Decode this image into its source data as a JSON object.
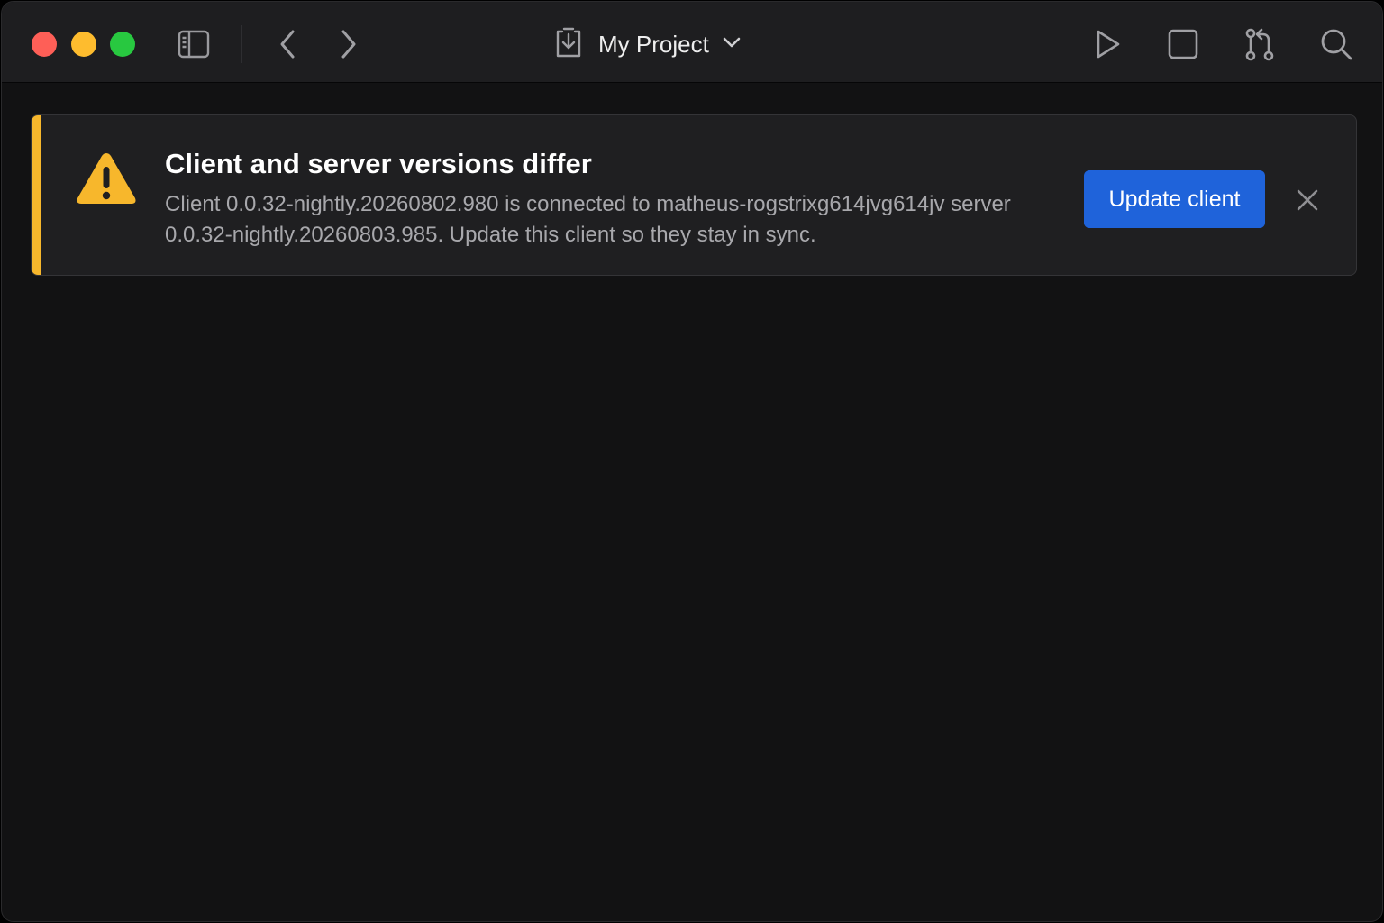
{
  "window": {
    "traffic_lights": {
      "close_color": "#fe5f57",
      "minimize_color": "#febc2e",
      "maximize_color": "#28c840"
    }
  },
  "toolbar": {
    "left_icons": [
      "sidebar-toggle-icon",
      "chevron-left-icon",
      "chevron-right-icon"
    ],
    "project": {
      "icon": "project-download-icon",
      "name": "My Project",
      "dropdown_icon": "chevron-down-icon"
    },
    "right_icons": [
      "play-icon",
      "stop-icon",
      "git-pull-request-icon",
      "search-icon"
    ]
  },
  "banner": {
    "severity": "warning",
    "accent_color": "#f7b72c",
    "icon": "warning-triangle-icon",
    "title": "Client and server versions differ",
    "message": "Client 0.0.32-nightly.20260802.980 is connected to matheus-rogstrixg614jvg614jv server 0.0.32-nightly.20260803.985. Update this client so they stay in sync.",
    "action_label": "Update client",
    "action_color": "#1f63da",
    "dismiss_icon": "close-icon"
  }
}
